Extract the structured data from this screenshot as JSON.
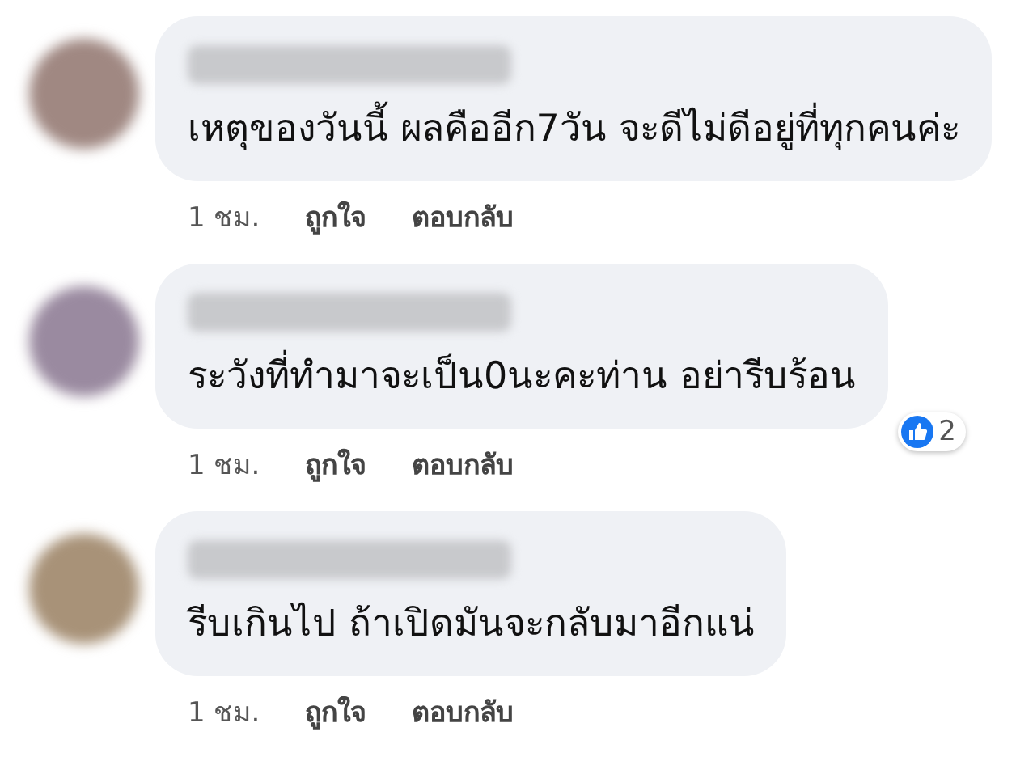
{
  "comments": [
    {
      "color": "#a08882",
      "text": "เหตุของวันนี้ ผลคืออีก7วัน จะดีไม่ดีอยู่ที่ทุกคนค่ะ",
      "time": "1 ชม.",
      "like": "ถูกใจ",
      "reply": "ตอบกลับ"
    },
    {
      "color": "#9a8aa0",
      "text": "ระวังที่ทำมาจะเป็น0นะคะท่าน อย่ารีบร้อน",
      "time": "1 ชม.",
      "like": "ถูกใจ",
      "reply": "ตอบกลับ",
      "reaction_count": "2"
    },
    {
      "color": "#a89278",
      "text": "รีบเกินไป ถ้าเปิดมันจะกลับมาอีกแน่",
      "time": "1 ชม.",
      "like": "ถูกใจ",
      "reply": "ตอบกลับ"
    }
  ]
}
